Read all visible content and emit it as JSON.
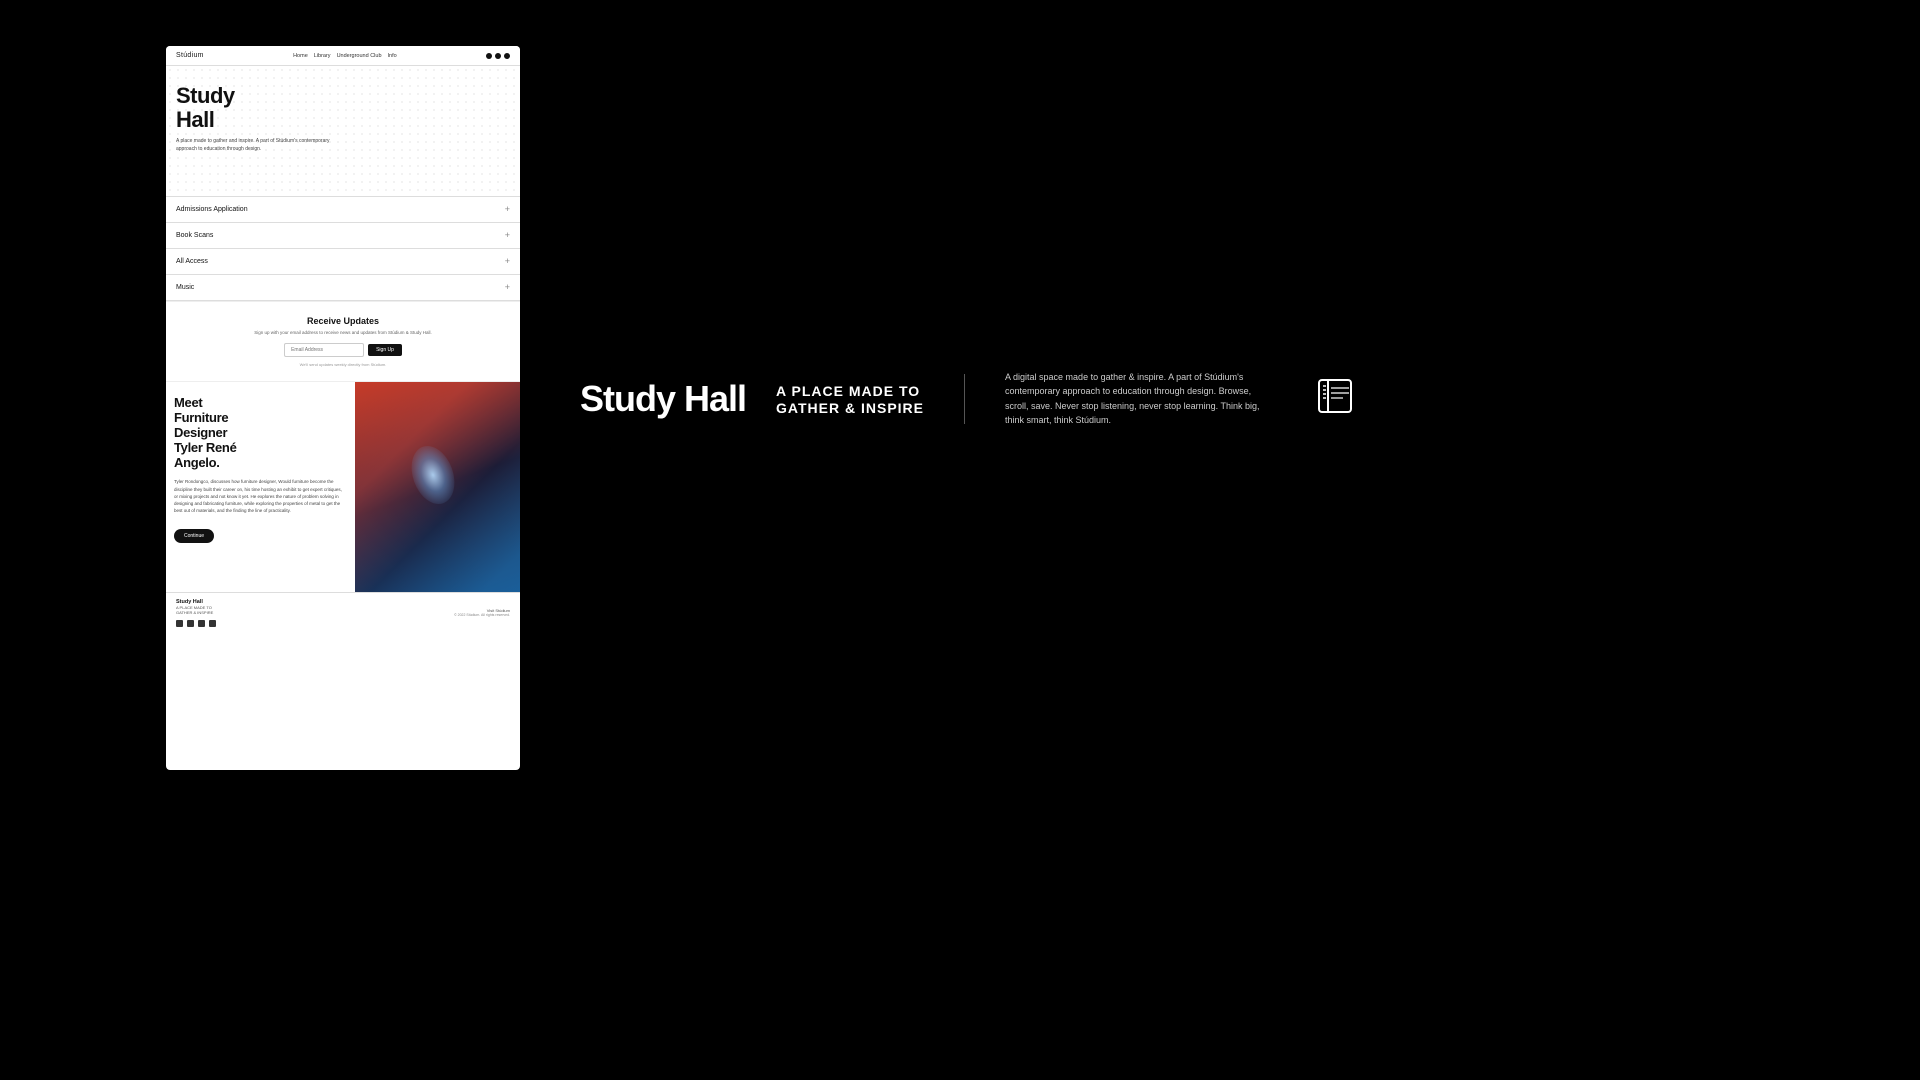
{
  "site": {
    "logo": "Stúdium",
    "nav_links": [
      "Home",
      "Library",
      "Underground Club",
      "Info"
    ],
    "hero": {
      "title_line1": "Study",
      "title_line2": "Hall",
      "subtitle": "A place made to gather and inspire. A part of Stúdium's contemporary approach to education through design."
    },
    "menu_items": [
      {
        "label": "Admissions Application",
        "icon": "+"
      },
      {
        "label": "Book Scans",
        "icon": "+"
      },
      {
        "label": "All Access",
        "icon": "+"
      },
      {
        "label": "Music",
        "icon": "+"
      }
    ],
    "newsletter": {
      "title": "Receive Updates",
      "description": "Sign up with your email address to receive news and updates from Stúdium & Study Hall.",
      "input_placeholder": "Email Address",
      "button_label": "Sign Up",
      "fine_print": "We'll send updates weekly directly from Stúdium."
    },
    "feature": {
      "title_line1": "Meet",
      "title_line2": "Furniture",
      "title_line3": "Designer",
      "title_line4": "Tyler René",
      "title_line5": "Angelo.",
      "body": "Tyler Rondongco, discusses how furniture designer, Would furniture become the discipline they built their career on, his time hosting an exhibit to get expert critiques, or mixing projects and not know it yet. He explores the nature of problem solving in designing and fabricating furniture, while exploring the properties of metal to get the best out of materials, and the finding the line of practicality.",
      "button_label": "Continue"
    },
    "footer": {
      "logo": "Study Hall",
      "tagline_line1": "A PLACE MADE TO",
      "tagline_line2": "GATHER & INSPIRE",
      "legal": "© 2022 Stúdium. All rights reserved.",
      "visit_text": "Visit Stúdium"
    }
  },
  "branding": {
    "title": "Study Hall",
    "tagline_line1": "A PLACE MADE TO",
    "tagline_line2": "GATHER & INSPIRE",
    "description": "A digital space made to gather & inspire. A part of Stúdium's contemporary approach to education through design. Browse, scroll, save. Never stop listening, never stop learning. Think big, think smart, think Stúdium."
  }
}
